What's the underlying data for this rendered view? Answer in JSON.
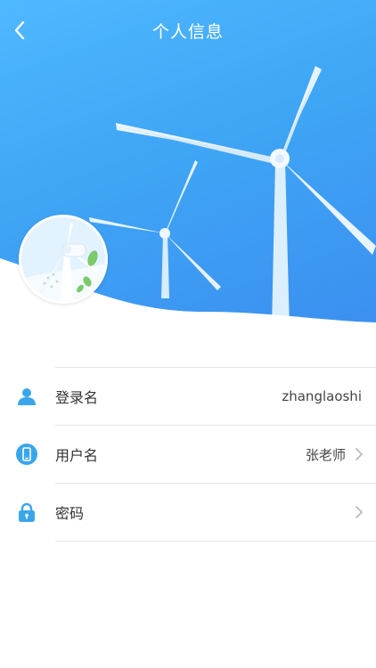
{
  "nav": {
    "title": "个人信息",
    "back_icon": "chevron-left-icon"
  },
  "colors": {
    "header_blue": "#3fa6f5",
    "icon_blue": "#3ba5ec",
    "text": "#333333"
  },
  "profile": {
    "avatar_icon": "wind-turbine-avatar"
  },
  "rows": [
    {
      "label": "登录名",
      "value": "zhanglaoshi",
      "icon": "user-icon",
      "has_arrow": false
    },
    {
      "label": "用户名",
      "value": "张老师",
      "icon": "phone-icon",
      "has_arrow": true
    },
    {
      "label": "密码",
      "value": "",
      "icon": "lock-icon",
      "has_arrow": true
    }
  ]
}
